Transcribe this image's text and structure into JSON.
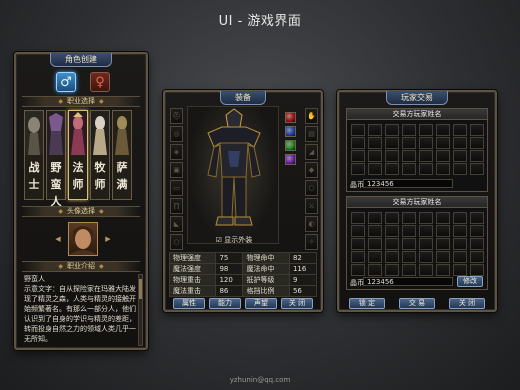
{
  "page": {
    "title": "UI - 游戏界面",
    "footer": "yzhunin@qq.com"
  },
  "colors": {
    "panel_border": "#5d5444",
    "button": "#2c4468",
    "header": "#2a3a58",
    "gold_text": "#e3cf9a"
  },
  "left_panel": {
    "title": "角色创建",
    "gender_icons": [
      "male-icon",
      "female-icon"
    ],
    "class_section": "职业选择",
    "classes": [
      {
        "name": "战士",
        "chars": [
          "战",
          "士"
        ]
      },
      {
        "name": "野蛮人",
        "chars": [
          "野",
          "蛮",
          "人"
        ]
      },
      {
        "name": "法师",
        "chars": [
          "法",
          "师"
        ]
      },
      {
        "name": "牧师",
        "chars": [
          "牧",
          "师"
        ]
      },
      {
        "name": "萨满",
        "chars": [
          "萨",
          "满"
        ]
      }
    ],
    "avatar_section": "头像选择",
    "intro_section": "职业介绍",
    "intro_name": "野蛮人",
    "intro_text": "示意文字：自从探险家在玛雅大陆发现了精灵之森，人类与精灵的接触开始频繁著名。有那么一部分人，他们认识到了自身的学识与精灵的差距，转而投身自然之力的领域人类几乎一无所知。"
  },
  "equipment": {
    "title": "装备",
    "show_outfit": "显示外装",
    "gem_colors": [
      "#b21c1c",
      "#2a4fb8",
      "#2a9a2a",
      "#7a2ab8"
    ],
    "stats": [
      {
        "l1": "物理强度",
        "v1": "75",
        "l2": "物理命中",
        "v2": "82"
      },
      {
        "l1": "魔法强度",
        "v1": "98",
        "l2": "魔法命中",
        "v2": "116"
      },
      {
        "l1": "物理重击",
        "v1": "120",
        "l2": "抵护等级",
        "v2": "9"
      },
      {
        "l1": "魔法重击",
        "v1": "86",
        "l2": "格挡比例",
        "v2": "56"
      }
    ],
    "buttons": [
      "属性",
      "能力",
      "声望",
      "关 闭"
    ]
  },
  "trade": {
    "title": "玩家交易",
    "top_name": "交易方玩家姓名",
    "bottom_name": "交易方玩家姓名",
    "money_label": "晶币",
    "top_money": "123456",
    "bottom_money": "123456",
    "modify": "修改",
    "buttons": [
      "锁 定",
      "交 易",
      "关 闭"
    ]
  }
}
